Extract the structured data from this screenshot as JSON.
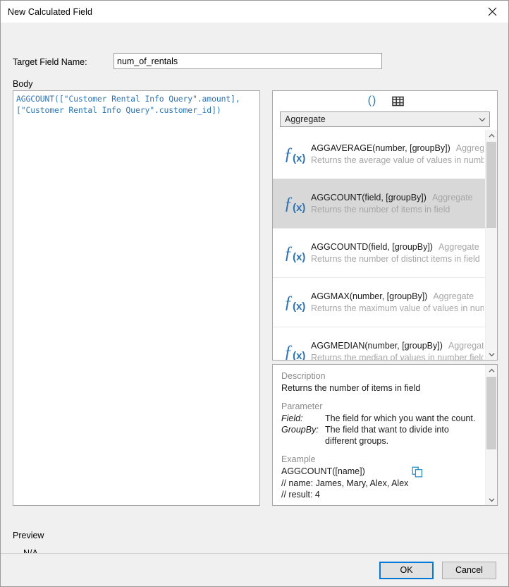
{
  "window": {
    "title": "New Calculated Field",
    "close_icon": "close-icon"
  },
  "form": {
    "target_field_label": "Target Field Name:",
    "target_field_value": "num_of_rentals",
    "target_field_placeholder": "",
    "body_label": "Body",
    "body_code": "AGGCOUNT([\"Customer Rental Info Query\".amount],\n[\"Customer Rental Info Query\".customer_id])"
  },
  "function_browser": {
    "toolbar": {
      "parentheses_icon": "parentheses-icon",
      "parentheses_label": "()",
      "table_icon": "table-grid-icon"
    },
    "category_select": {
      "value": "Aggregate",
      "chevron_icon": "chevron-down-icon"
    },
    "items": [
      {
        "signature": "AGGAVERAGE(number, [groupBy])",
        "category": "Aggregate",
        "description": "Returns the average value of values in number",
        "selected": false
      },
      {
        "signature": "AGGCOUNT(field, [groupBy])",
        "category": "Aggregate",
        "description": "Returns the number of items in field",
        "selected": true
      },
      {
        "signature": "AGGCOUNTD(field, [groupBy])",
        "category": "Aggregate",
        "description": "Returns the number of distinct items in field",
        "selected": false
      },
      {
        "signature": "AGGMAX(number, [groupBy])",
        "category": "Aggregate",
        "description": "Returns the maximum value of values in numb",
        "selected": false
      },
      {
        "signature": "AGGMEDIAN(number, [groupBy])",
        "category": "Aggregate",
        "description": "Returns the median of values in number field",
        "selected": false
      }
    ],
    "scrollbar": {
      "up_icon": "scroll-up-arrow-icon",
      "down_icon": "scroll-down-arrow-icon"
    }
  },
  "description_panel": {
    "description_heading": "Description",
    "description_text": "Returns the number of items in field",
    "parameter_heading": "Parameter",
    "parameters": [
      {
        "name": "Field:",
        "text": "The field for which you want the count."
      },
      {
        "name": "GroupBy:",
        "text": "The field that want to divide into"
      }
    ],
    "parameter_continuation": "different groups.",
    "example_heading": "Example",
    "example_code": "AGGCOUNT([name])",
    "example_comment_1": "// name: James, Mary, Alex, Alex",
    "example_comment_2": "// result: 4",
    "copy_icon": "copy-icon",
    "scrollbar": {
      "up_icon": "scroll-up-arrow-icon",
      "down_icon": "scroll-down-arrow-icon"
    }
  },
  "preview": {
    "label": "Preview",
    "value": "N/A"
  },
  "footer": {
    "ok_label": "OK",
    "cancel_label": "Cancel"
  },
  "colors": {
    "accent": "#2e74b5",
    "focus_border": "#0078d7",
    "selected_row": "#d8d8d8",
    "muted_text": "#a6a6a6"
  }
}
